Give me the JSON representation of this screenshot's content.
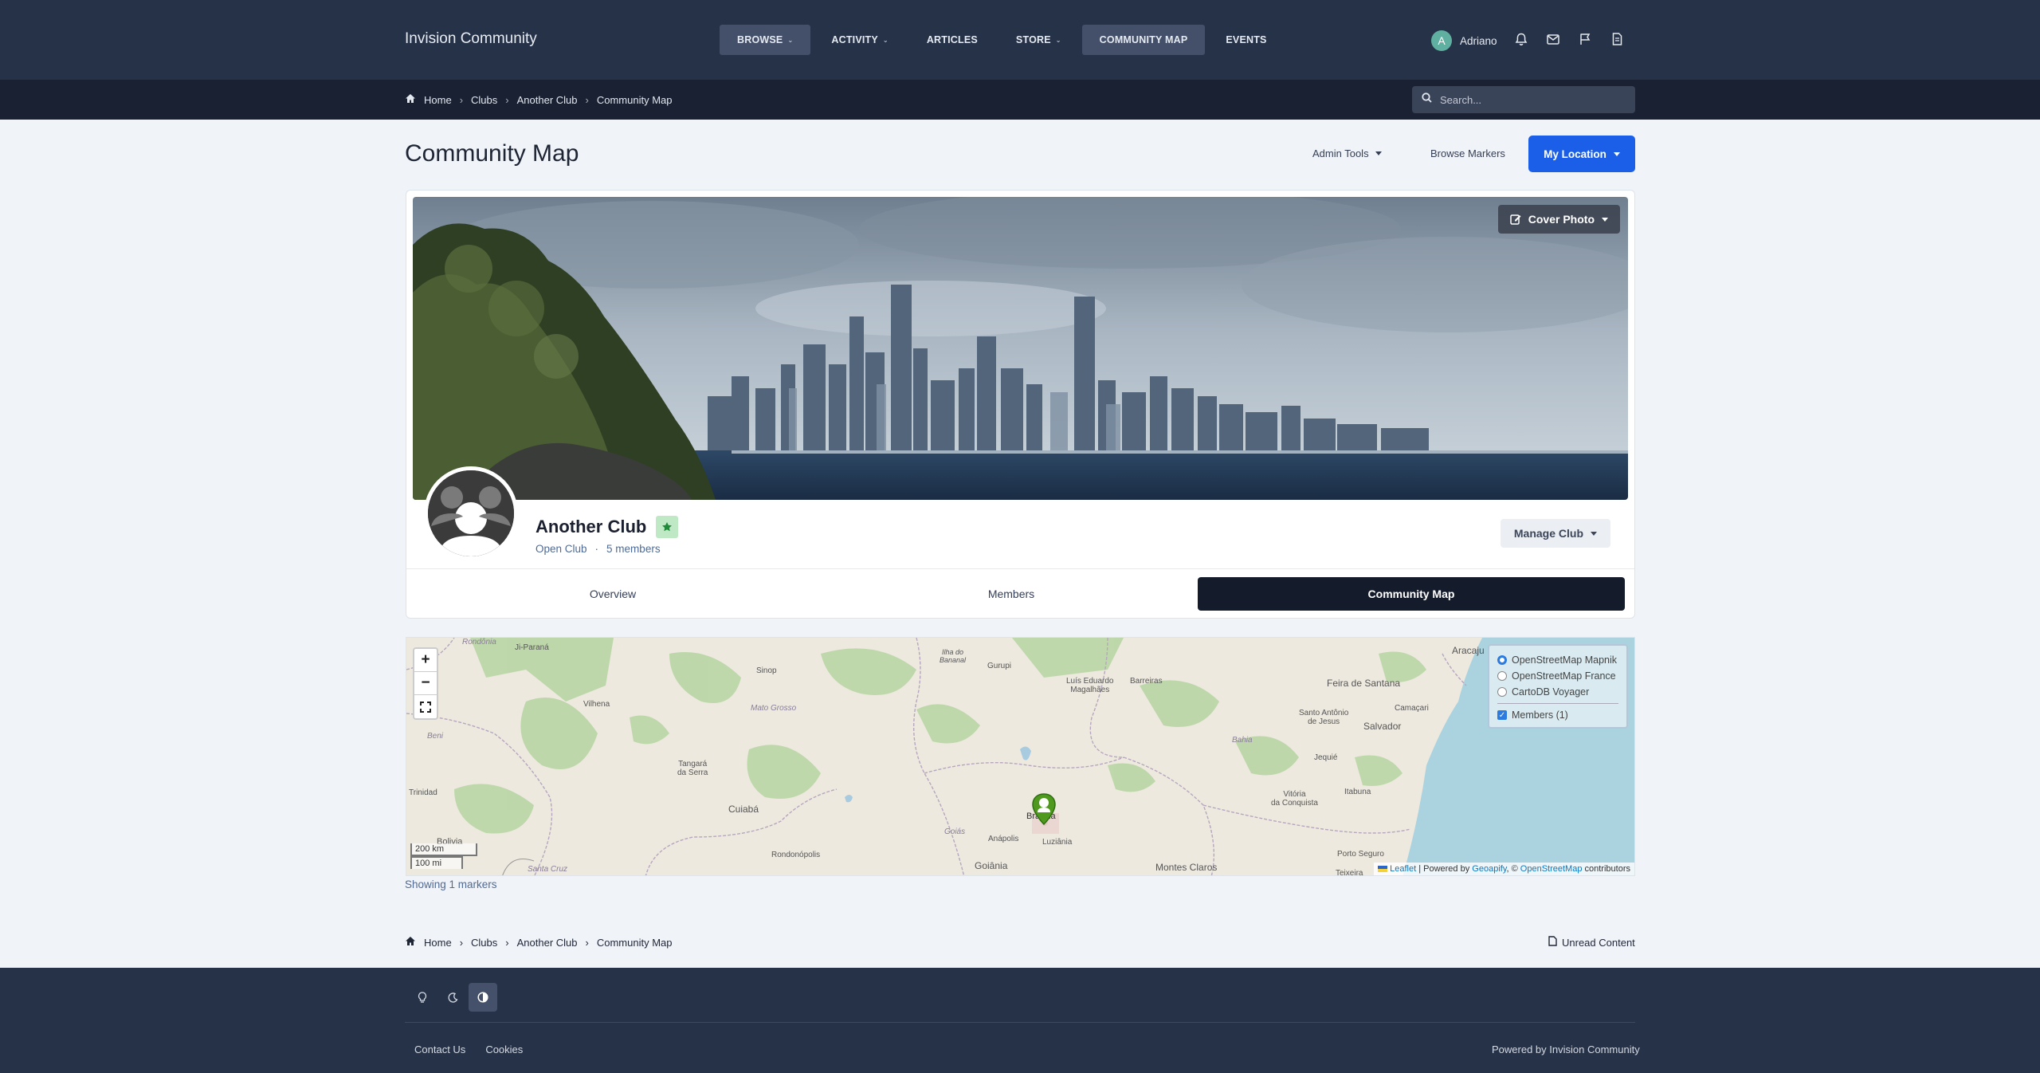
{
  "header": {
    "brand": "Invision Community",
    "nav": [
      {
        "label": "BROWSE",
        "caret": "⌄"
      },
      {
        "label": "ACTIVITY",
        "caret": "⌄"
      },
      {
        "label": "ARTICLES",
        "caret": ""
      },
      {
        "label": "STORE",
        "caret": "⌄"
      },
      {
        "label": "COMMUNITY MAP",
        "caret": ""
      },
      {
        "label": "EVENTS",
        "caret": ""
      }
    ],
    "user": {
      "initial": "A",
      "name": "Adriano"
    },
    "icons": [
      "bell-icon",
      "envelope-icon",
      "flag-icon",
      "document-icon"
    ]
  },
  "breadcrumb": {
    "home": "Home",
    "items": [
      "Clubs",
      "Another Club",
      "Community Map"
    ]
  },
  "search": {
    "placeholder": "Search..."
  },
  "page": {
    "title": "Community Map",
    "admin_tools": "Admin Tools",
    "browse_markers": "Browse Markers",
    "my_location": "My Location"
  },
  "club": {
    "cover_button": "Cover Photo",
    "name": "Another Club",
    "type": "Open Club",
    "separator": "·",
    "members": "5 members",
    "manage_button": "Manage Club",
    "tabs": [
      "Overview",
      "Members",
      "Community Map"
    ],
    "active_tab": "Community Map"
  },
  "map": {
    "layers": [
      "OpenStreetMap Mapnik",
      "OpenStreetMap France",
      "CartoDB Voyager"
    ],
    "selected_layer": "OpenStreetMap Mapnik",
    "overlay": "Members (1)",
    "scale_km": "200 km",
    "scale_mi": "100 mi",
    "attribution": {
      "leaflet": "Leaflet",
      "powered": "| Powered by",
      "geoapify": "Geoapify",
      "copyright": ", ©",
      "osm": "OpenStreetMap",
      "contributors": "contributors"
    },
    "labels": {
      "rondonia": "Rondônia",
      "jiparana": "Ji-Paraná",
      "vilhena": "Vilhena",
      "beni": "Beni",
      "trinidad": "Trinidad",
      "bolivia": "Bolivia",
      "santacruz": "Santa Cruz",
      "sinop": "Sinop",
      "matogrosso": "Mato Grosso",
      "tangara": "Tangará\nda Serra",
      "cuiaba": "Cuiabá",
      "rondonopolis": "Rondonópolis",
      "ilhadobananal": "Ilha do\nBananal",
      "gurupi": "Gurupi",
      "luiseduardo": "Luís Eduardo\nMagalhães",
      "barreiras": "Barreiras",
      "goias": "Goiás",
      "brasilia": "Brasília",
      "anapolis": "Anápolis",
      "luziania": "Luziânia",
      "goiania": "Goiânia",
      "montesclaros": "Montes Claros",
      "bahia": "Bahia",
      "aracaju": "Aracaju",
      "feiradesantana": "Feira de Santana",
      "camacari": "Camaçari",
      "santoantonio": "Santo Antônio\nde Jesus",
      "salvador": "Salvador",
      "jequie": "Jequié",
      "vitoria": "Vitória\nda Conquista",
      "itabuna": "Itabuna",
      "portoseguro": "Porto Seguro",
      "teixeira": "Teixeira"
    }
  },
  "showing": "Showing 1 markers",
  "bottom": {
    "unread": "Unread Content"
  },
  "footer": {
    "theme_buttons": [
      "lightbulb-icon",
      "moon-icon",
      "contrast-icon"
    ],
    "links": [
      "Contact Us",
      "Cookies"
    ],
    "powered": "Powered by Invision Community"
  },
  "colors": {
    "header_bg": "#263248",
    "crumb_bg": "#192132",
    "accent": "#1b5fe8",
    "active_tab": "#141c2c"
  }
}
